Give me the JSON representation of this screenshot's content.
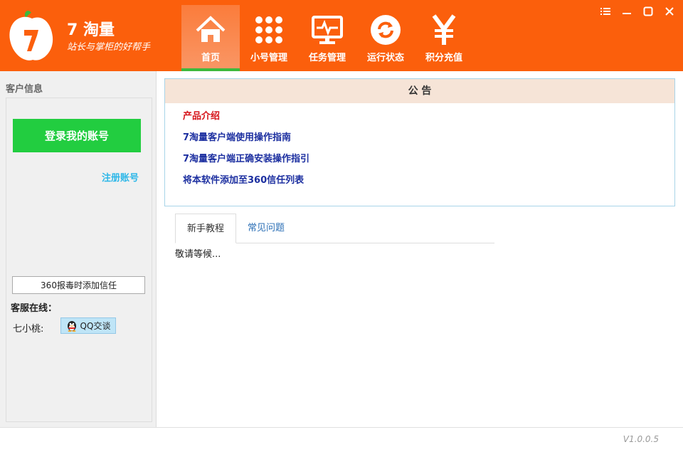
{
  "brand": {
    "name": "7 淘量",
    "slogan": "站长与掌柜的好帮手",
    "accent_color": "#fb5f0c"
  },
  "nav": {
    "items": [
      {
        "label": "首页",
        "icon": "home-icon",
        "active": true
      },
      {
        "label": "小号管理",
        "icon": "grid-dots-icon",
        "active": false
      },
      {
        "label": "任务管理",
        "icon": "monitor-pulse-icon",
        "active": false
      },
      {
        "label": "运行状态",
        "icon": "refresh-icon",
        "active": false
      },
      {
        "label": "积分充值",
        "icon": "yen-icon",
        "active": false
      }
    ]
  },
  "window_controls": [
    "menu-icon",
    "minimize-icon",
    "maximize-icon",
    "close-icon"
  ],
  "left_panel": {
    "title": "客户信息",
    "login_button": "登录我的账号",
    "register_link": "注册账号",
    "trust_button": "360报毒时添加信任",
    "service_title": "客服在线：",
    "service_name": "七小桃:",
    "qq_button": "QQ交谈"
  },
  "notice": {
    "title": "公 告",
    "links": [
      {
        "text": "产品介绍",
        "color": "#d6141a"
      },
      {
        "text": "7淘量客户端使用操作指南",
        "color": "#1c2fa0"
      },
      {
        "text": "7淘量客户端正确安装操作指引",
        "color": "#1c2fa0"
      },
      {
        "text": "将本软件添加至360信任列表",
        "color": "#1c2fa0"
      }
    ]
  },
  "tabs": {
    "items": [
      {
        "label": "新手教程",
        "active": true
      },
      {
        "label": "常见问题",
        "active": false
      }
    ],
    "content": "敬请等候..."
  },
  "footer": {
    "version": "V1.0.0.5"
  }
}
